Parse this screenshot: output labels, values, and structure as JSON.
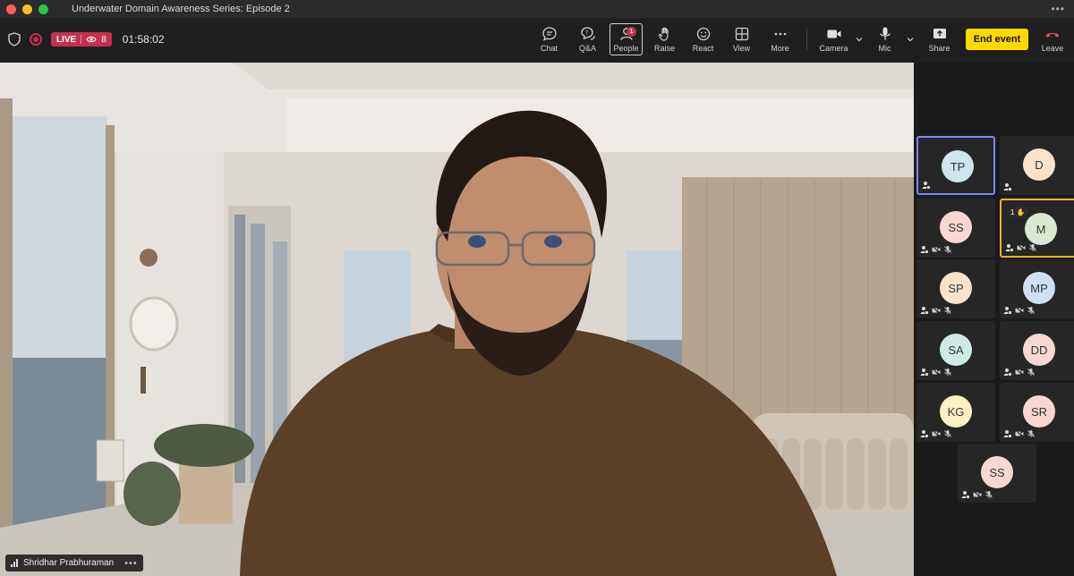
{
  "window": {
    "title": "Underwater Domain Awareness Series: Episode 2"
  },
  "status": {
    "live_label": "LIVE",
    "viewer_count": "8",
    "elapsed": "01:58:02"
  },
  "toolbar": {
    "chat": "Chat",
    "qa": "Q&A",
    "people": "People",
    "people_badge": "1",
    "raise": "Raise",
    "react": "React",
    "view": "View",
    "more": "More",
    "camera": "Camera",
    "mic": "Mic",
    "share": "Share",
    "end_event": "End event",
    "leave": "Leave"
  },
  "main_video": {
    "speaker_name": "Shridhar Prabhuraman"
  },
  "participants": [
    {
      "initials": "TP",
      "color": "#cfe4ec"
    },
    {
      "initials": "D",
      "color": "#fbe3c9"
    },
    {
      "initials": "SS",
      "color": "#f8d7d3"
    },
    {
      "initials": "M",
      "color": "#dbe9d2",
      "hand": "1"
    },
    {
      "initials": "SP",
      "color": "#fbe3c9"
    },
    {
      "initials": "MP",
      "color": "#cfe0f5"
    },
    {
      "initials": "SA",
      "color": "#cdebe5"
    },
    {
      "initials": "DD",
      "color": "#f8d7d3"
    },
    {
      "initials": "KG",
      "color": "#fdf0c4"
    },
    {
      "initials": "SR",
      "color": "#f8d7d3"
    },
    {
      "initials": "SS",
      "color": "#f8d7d3"
    }
  ],
  "colors": {
    "live": "#c4314b",
    "end_event": "#ffd800",
    "selected_outline": "#7f85f5",
    "raised_hand_outline": "#e8b52a"
  }
}
